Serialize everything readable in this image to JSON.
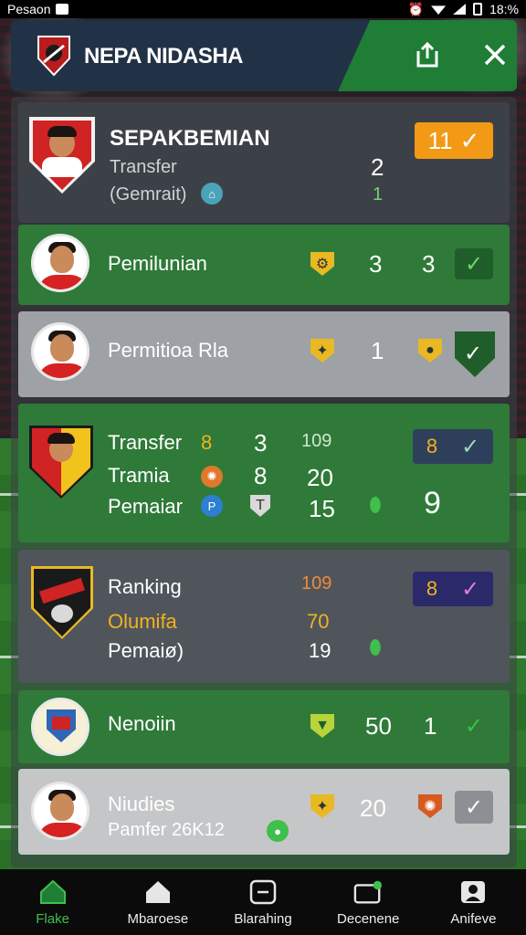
{
  "status_bar": {
    "carrier": "Pesaon",
    "time": "18:%"
  },
  "header": {
    "title": "NEPA NIDASHA"
  },
  "rows": {
    "r1": {
      "title": "SEPAKBEMIAN",
      "line2": "Transfer",
      "line3": "(Gemrait)",
      "val_a": "2",
      "val_b": "1",
      "badge": "11"
    },
    "r2": {
      "name": "Pemilunian",
      "v1": "3",
      "v2": "3"
    },
    "r3": {
      "name": "Permitioa Rla",
      "v1": "1"
    },
    "r4": {
      "l1": "Transfer",
      "l1a": "8",
      "l1b": "3",
      "l1c": "109",
      "l2": "Tramia",
      "l2b": "8",
      "l2c": "20",
      "l3": "Pemaiar",
      "l3c": "15",
      "badge": "8",
      "big": "9"
    },
    "r5": {
      "l1": "Ranking",
      "l1c": "109",
      "l2": "Olumifa",
      "l2c": "70",
      "l3": "Pemaiø)",
      "l3c": "19",
      "badge": "8"
    },
    "r6": {
      "name": "Nenoiin",
      "v1": "50",
      "v2": "1"
    },
    "r7": {
      "name": "Niudies",
      "sub": "Pamfer 26K12",
      "v1": "20"
    }
  },
  "bottom_nav": [
    {
      "label": "Flake",
      "icon": "home-icon"
    },
    {
      "label": "Mbaroese",
      "icon": "house-icon"
    },
    {
      "label": "Blarahing",
      "icon": "chat-icon"
    },
    {
      "label": "Decenene",
      "icon": "message-icon"
    },
    {
      "label": "Anifeve",
      "icon": "profile-icon"
    }
  ],
  "colors": {
    "accent_green": "#2f7a38",
    "badge_orange": "#f29a16",
    "header_navy": "#223246"
  }
}
